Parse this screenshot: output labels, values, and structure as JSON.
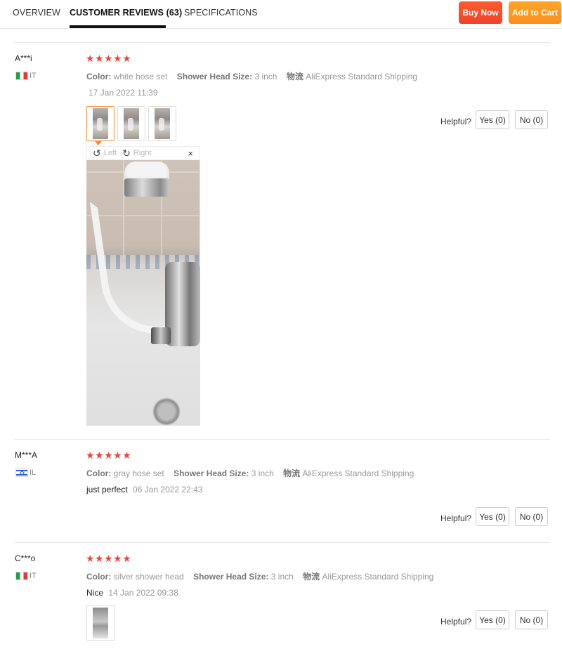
{
  "tabs": [
    {
      "label": "OVERVIEW"
    },
    {
      "label": "CUSTOMER REVIEWS (63)"
    },
    {
      "label": "SPECIFICATIONS"
    }
  ],
  "actions": {
    "buy_now": "Buy Now",
    "add_to_cart": "Add to Cart"
  },
  "labels": {
    "color": "Color:",
    "shower_head_size": "Shower Head Size:",
    "logistics": "物流",
    "helpful": "Helpful?",
    "yes": "Yes (0)",
    "no": "No (0)"
  },
  "viewer": {
    "left": "Left",
    "right": "Right",
    "close": "×",
    "rotate_left_glyph": "↺",
    "rotate_right_glyph": "↻"
  },
  "reviews": [
    {
      "name": "A***i",
      "country": "IT",
      "stars": "★★★★★",
      "color": "white hose set",
      "size": "3 inch",
      "shipping": "AliExpress Standard Shipping",
      "text": "",
      "date": "17 Jan 2022 11:39"
    },
    {
      "name": "M***A",
      "country": "IL",
      "stars": "★★★★★",
      "color": "gray hose set",
      "size": "3 inch",
      "shipping": "AliExpress Standard Shipping",
      "text": "just perfect",
      "date": "06 Jan 2022 22:43"
    },
    {
      "name": "C***o",
      "country": "IT",
      "stars": "★★★★★",
      "color": "silver shower head",
      "size": "3 inch",
      "shipping": "AliExpress Standard Shipping",
      "text": "Nice",
      "date": "14 Jan 2022 09:38"
    }
  ],
  "colors": {
    "accent_star": "#e8463a",
    "buy_now": "#f0432a",
    "add_to_cart": "#fa8f1d",
    "active_thumb": "#ff8b3d"
  }
}
